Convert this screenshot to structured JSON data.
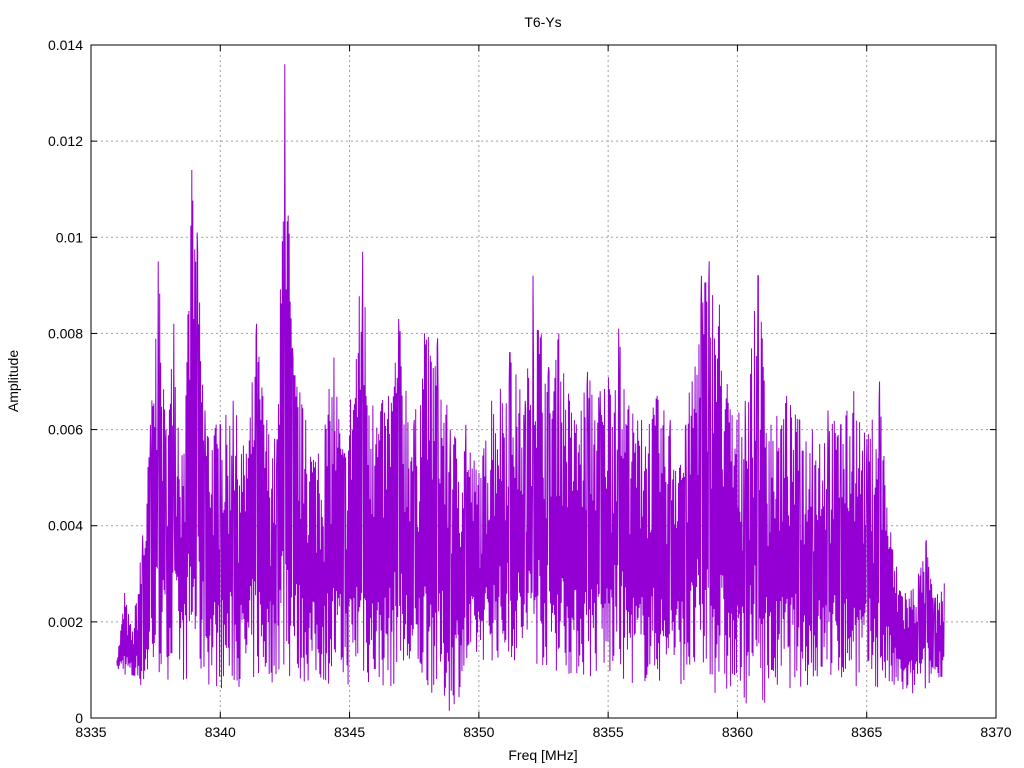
{
  "chart_data": {
    "type": "line",
    "title": "T6-Ys",
    "xlabel": "Freq [MHz]",
    "ylabel": "Amplitude",
    "xlim": [
      8335,
      8370
    ],
    "ylim": [
      0,
      0.014
    ],
    "x_ticks": [
      "8335",
      "8340",
      "8345",
      "8350",
      "8355",
      "8360",
      "8365",
      "8370"
    ],
    "y_ticks": [
      "0",
      "0.002",
      "0.004",
      "0.006",
      "0.008",
      "0.01",
      "0.012",
      "0.014"
    ],
    "grid": true,
    "line_color": "#9400d3",
    "series": [
      {
        "x_start": 8336.0,
        "x_end": 8368.0,
        "envelope_points": [
          [
            8336.0,
            0.0012
          ],
          [
            8336.3,
            0.0026
          ],
          [
            8336.6,
            0.0018
          ],
          [
            8337.0,
            0.0038
          ],
          [
            8337.3,
            0.0061
          ],
          [
            8337.6,
            0.0095
          ],
          [
            8337.9,
            0.006
          ],
          [
            8338.2,
            0.0082
          ],
          [
            8338.6,
            0.0055
          ],
          [
            8338.9,
            0.0114
          ],
          [
            8339.1,
            0.0101
          ],
          [
            8339.4,
            0.0064
          ],
          [
            8340.0,
            0.0061
          ],
          [
            8340.5,
            0.0066
          ],
          [
            8341.0,
            0.0055
          ],
          [
            8341.4,
            0.0082
          ],
          [
            8341.8,
            0.0062
          ],
          [
            8342.2,
            0.0058
          ],
          [
            8342.5,
            0.0136
          ],
          [
            8342.8,
            0.0077
          ],
          [
            8343.3,
            0.0062
          ],
          [
            8343.8,
            0.0055
          ],
          [
            8344.4,
            0.0075
          ],
          [
            8344.8,
            0.0055
          ],
          [
            8345.5,
            0.0097
          ],
          [
            8345.9,
            0.0065
          ],
          [
            8346.5,
            0.0067
          ],
          [
            8346.9,
            0.0083
          ],
          [
            8347.5,
            0.0062
          ],
          [
            8347.9,
            0.008
          ],
          [
            8348.4,
            0.0079
          ],
          [
            8348.9,
            0.006
          ],
          [
            8349.5,
            0.0061
          ],
          [
            8350.0,
            0.0051
          ],
          [
            8350.5,
            0.0066
          ],
          [
            8351.2,
            0.0076
          ],
          [
            8351.8,
            0.0066
          ],
          [
            8352.1,
            0.0092
          ],
          [
            8352.7,
            0.0073
          ],
          [
            8353.1,
            0.008
          ],
          [
            8353.7,
            0.0062
          ],
          [
            8354.2,
            0.0072
          ],
          [
            8354.7,
            0.0068
          ],
          [
            8355.4,
            0.0081
          ],
          [
            8355.8,
            0.0065
          ],
          [
            8356.3,
            0.0062
          ],
          [
            8356.9,
            0.0067
          ],
          [
            8357.4,
            0.0062
          ],
          [
            8358.0,
            0.0061
          ],
          [
            8358.6,
            0.0092
          ],
          [
            8358.9,
            0.0095
          ],
          [
            8359.3,
            0.0086
          ],
          [
            8359.8,
            0.0063
          ],
          [
            8360.3,
            0.0066
          ],
          [
            8360.8,
            0.0092
          ],
          [
            8361.3,
            0.0061
          ],
          [
            8361.9,
            0.0067
          ],
          [
            8362.4,
            0.0062
          ],
          [
            8362.9,
            0.006
          ],
          [
            8363.5,
            0.0064
          ],
          [
            8364.0,
            0.0061
          ],
          [
            8364.5,
            0.0068
          ],
          [
            8365.0,
            0.0058
          ],
          [
            8365.5,
            0.007
          ],
          [
            8366.0,
            0.0035
          ],
          [
            8366.5,
            0.0026
          ],
          [
            8367.0,
            0.003
          ],
          [
            8367.3,
            0.0037
          ],
          [
            8367.6,
            0.0025
          ],
          [
            8368.0,
            0.0028
          ]
        ],
        "floor_points": [
          [
            8336.0,
            0.001
          ],
          [
            8337.0,
            0.0006
          ],
          [
            8338.0,
            0.0008
          ],
          [
            8339.0,
            0.0007
          ],
          [
            8340.0,
            0.0006
          ],
          [
            8342.0,
            0.0007
          ],
          [
            8344.0,
            0.0007
          ],
          [
            8346.0,
            0.0006
          ],
          [
            8348.0,
            0.0006
          ],
          [
            8348.9,
            0.0001
          ],
          [
            8350.0,
            0.0012
          ],
          [
            8352.0,
            0.0011
          ],
          [
            8354.0,
            0.0008
          ],
          [
            8356.0,
            0.0007
          ],
          [
            8358.0,
            0.0007
          ],
          [
            8360.0,
            0.0003
          ],
          [
            8361.0,
            0.0003
          ],
          [
            8362.0,
            0.0006
          ],
          [
            8364.0,
            0.0007
          ],
          [
            8366.0,
            0.0005
          ],
          [
            8367.0,
            0.0004
          ],
          [
            8368.0,
            0.0009
          ]
        ]
      }
    ]
  }
}
